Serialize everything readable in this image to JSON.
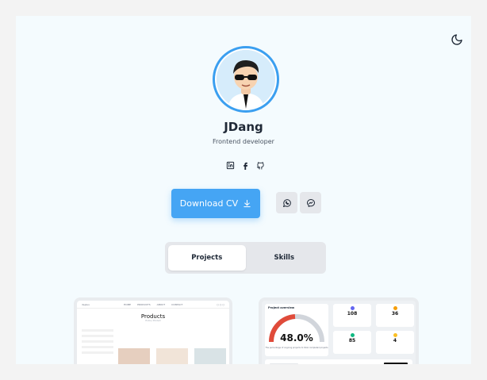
{
  "profile": {
    "name": "JDang",
    "role": "Frontend developer"
  },
  "socials": [
    {
      "icon": "linkedin-icon"
    },
    {
      "icon": "facebook-icon"
    },
    {
      "icon": "github-icon"
    }
  ],
  "actions": {
    "download_label": "Download CV",
    "download_icon": "download-icon",
    "whatsapp_icon": "whatsapp-icon",
    "messenger_icon": "messenger-icon"
  },
  "tabs": [
    {
      "label": "Projects",
      "active": true
    },
    {
      "label": "Skills",
      "active": false
    }
  ],
  "projects": {
    "shop_preview": {
      "brand": "dejavu",
      "nav": [
        "HOME",
        "PRODUCTS",
        "ABOUT",
        "CONTACT"
      ],
      "title": "Products",
      "subtitle": "Home / Product"
    },
    "dashboard_preview": {
      "overview_title": "Project overview",
      "overview_value": "48.0%",
      "overview_caption": "The percentage of ongoing projects to total completed projects",
      "stats": [
        {
          "value": "108",
          "color": "#6366f1"
        },
        {
          "value": "36",
          "color": "#f59e0b"
        },
        {
          "value": "85",
          "color": "#10b981"
        },
        {
          "value": "4",
          "color": "#fbbf24"
        }
      ]
    }
  },
  "colors": {
    "accent": "#45a5f4",
    "page_bg": "#f4fbfe",
    "gauge_red": "#e04b3a"
  }
}
